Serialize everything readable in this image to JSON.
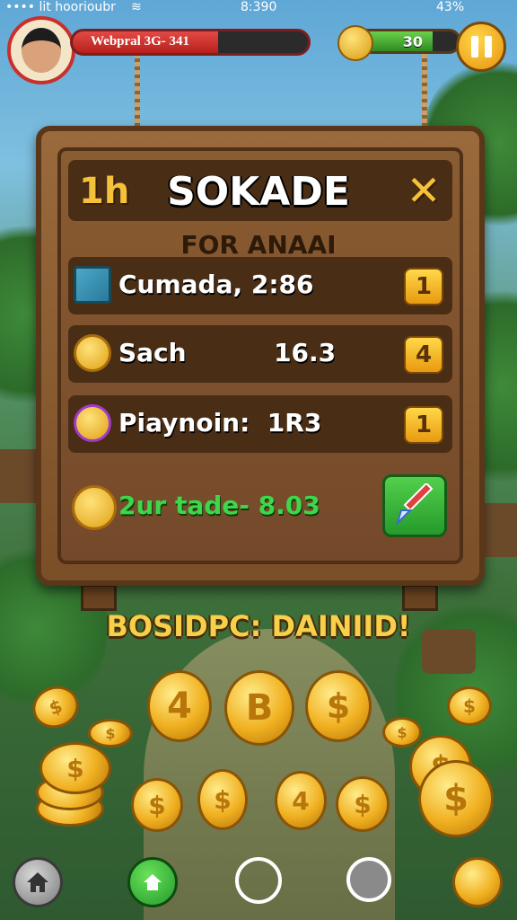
{
  "status_bar": {
    "carrier": "•••• lit hoorioubr",
    "time": "8:390",
    "battery": "43%"
  },
  "hud": {
    "player_name": "Webpral 3G- 341",
    "health_fraction": 0.62,
    "energy_value": "30",
    "energy_fraction": 0.75,
    "icons": {
      "energy": "acorn-coin-icon",
      "pause": "pause-icon"
    }
  },
  "panel": {
    "level_number": "1h",
    "title": "SOKADE",
    "subtitle": "FOR ANAAI",
    "rows": [
      {
        "icon": "pencil-note-icon",
        "label": "Cumada, 2:86",
        "count": "1"
      },
      {
        "icon": "coin-icon",
        "label": "Sach          16.3",
        "count": "4"
      },
      {
        "icon": "purple-coin-icon",
        "label": "Piaynoin:  1R3",
        "count": "1"
      }
    ],
    "trade_label": "2ur tade- 8.03"
  },
  "bonus_text": "BOSIDPC: DAINIID!",
  "coin_symbols": [
    "4",
    "B",
    "$"
  ],
  "nav": {
    "items": [
      "home-icon",
      "house-green-icon",
      "circle-white-icon",
      "circle-grey-icon",
      "coin-icon"
    ]
  },
  "colors": {
    "accent": "#f3c23a",
    "wood": "#7a4f28",
    "trade_green": "#3ed64a"
  }
}
